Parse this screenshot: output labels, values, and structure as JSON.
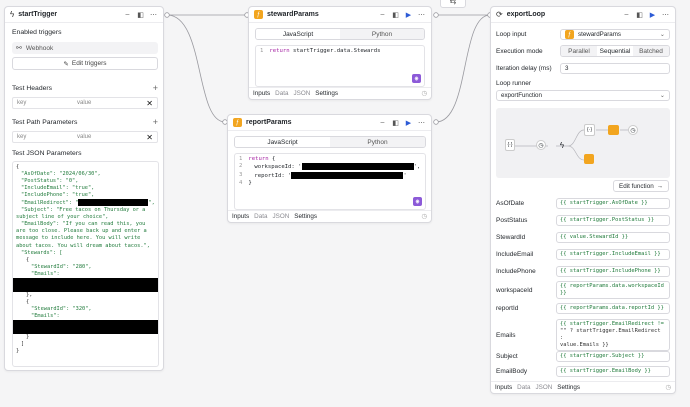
{
  "colors": {
    "accent": "#2d5bd6",
    "function_icon": "#f2a51f",
    "purple": "#8c5ad8",
    "code_string": "#1f7a3a"
  },
  "start": {
    "title": "startTrigger",
    "enabled_triggers": "Enabled triggers",
    "webhook": "Webhook",
    "edit_triggers": "Edit triggers",
    "headers_title": "Test Headers",
    "path_title": "Test Path Parameters",
    "kv_key": "key",
    "kv_value": "value",
    "json_title": "Test JSON Parameters",
    "json": {
      "l1": "{",
      "l2": "\"AsOfDate\": \"2024/06/30\",",
      "l3": "\"PostStatus\": \"0\",",
      "l4": "\"IncludeEmail\": \"true\",",
      "l5": "\"IncludePhone\": \"true\",",
      "l6": "\"EmailRedirect\": \"",
      "l6b": "\",",
      "l7": "\"Subject\": \"Free tacos on Thursday or a",
      "l8": "subject line of your choice\",",
      "l9": "\"EmailBody\": \"If you can read this, you",
      "l10": "are too close. Please back up and enter a",
      "l11": "message to include here. You will write",
      "l12": "about tacos. You will dream about tacos.\",",
      "l13": "\"Stewards\": [",
      "l14": "{",
      "l15": "\"StewardId\": \"280\",",
      "l16": "\"Emails\":",
      "l17": "},",
      "l18": "{",
      "l19": "\"StewardId\": \"320\",",
      "l20": "\"Emails\":",
      "l21": "}",
      "l22": "]",
      "l23": "}"
    }
  },
  "steward": {
    "title": "stewardParams",
    "tab_js": "JavaScript",
    "tab_py": "Python",
    "line_no": "1",
    "code_kw": "return",
    "code_rest": " startTrigger.data.Stewards",
    "footer": [
      "Inputs",
      "Data",
      "JSON",
      "Settings"
    ]
  },
  "report": {
    "title": "reportParams",
    "tab_js": "JavaScript",
    "tab_py": "Python",
    "lines": [
      "1",
      "2",
      "3",
      "4"
    ],
    "c1_kw": "return",
    "c1_rest": " {",
    "c2": "workspaceId: '",
    "c2_end": "',",
    "c3": "reportId: '",
    "c3_end": "'",
    "c4": "}",
    "footer": [
      "Inputs",
      "Data",
      "JSON",
      "Settings"
    ]
  },
  "loop": {
    "title": "exportLoop",
    "loop_input_label": "Loop input",
    "loop_input_value": "stewardParams",
    "exec_mode_label": "Execution mode",
    "mode_parallel": "Parallel",
    "mode_sequential": "Sequential",
    "mode_batched": "Batched",
    "delay_label": "Iteration delay (ms)",
    "delay_value": "3",
    "runner_label": "Loop runner",
    "runner_value": "exportFunction",
    "edit_function": "Edit function",
    "params": [
      {
        "name": "AsOfDate",
        "value": "{{ startTrigger.AsOfDate }}"
      },
      {
        "name": "PostStatus",
        "value": "{{ startTrigger.PostStatus }}"
      },
      {
        "name": "StewardId",
        "value": "{{ value.StewardId }}"
      },
      {
        "name": "IncludeEmail",
        "value": "{{ startTrigger.IncludeEmail }}"
      },
      {
        "name": "IncludePhone",
        "value": "{{ startTrigger.IncludePhone }}"
      },
      {
        "name": "workspaceId",
        "value": "{{ reportParams.data.workspaceId }}"
      },
      {
        "name": "reportId",
        "value": "{{ reportParams.data.reportId }}"
      },
      {
        "name": "Emails",
        "value1": "{{ startTrigger.EmailRedirect !=",
        "value2": "\"\" ? startTrigger.EmailRedirect :",
        "value3": "value.Emails }}"
      },
      {
        "name": "Subject",
        "value": "{{ startTrigger.Subject }}"
      },
      {
        "name": "EmailBody",
        "value": "{{ startTrigger.EmailBody }}"
      }
    ],
    "footer": [
      "Inputs",
      "Data",
      "JSON",
      "Settings"
    ]
  },
  "icons": {
    "trigger": "lightning-icon",
    "function": "function-icon",
    "run": "play-icon",
    "more": "more-dots-icon",
    "history": "history-icon",
    "branch": "branch-icon"
  }
}
